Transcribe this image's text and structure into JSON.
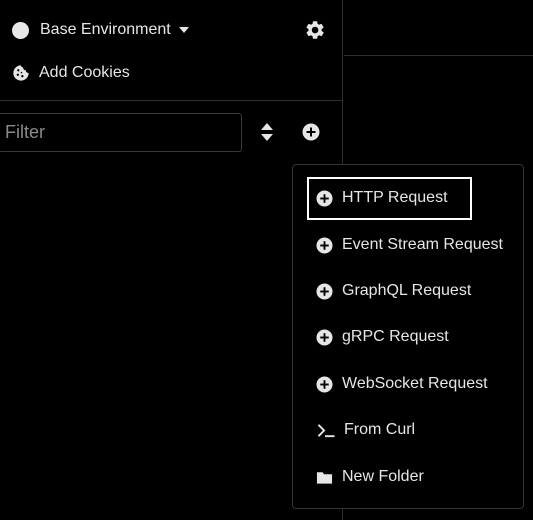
{
  "sidebar": {
    "environment": {
      "label": "Base Environment",
      "icon": "env-dot-icon"
    },
    "settings_icon": "gear-icon",
    "cookies": {
      "label": "Add Cookies",
      "icon": "cookie-icon"
    },
    "filter": {
      "placeholder": "Filter",
      "value": ""
    },
    "sort_icon": "sort-icon",
    "add_icon": "plus-circle-icon"
  },
  "create_menu": {
    "items": [
      {
        "label": "HTTP Request",
        "icon": "plus-circle-icon",
        "focused": true
      },
      {
        "label": "Event Stream Request",
        "icon": "plus-circle-icon"
      },
      {
        "label": "GraphQL Request",
        "icon": "plus-circle-icon"
      },
      {
        "label": "gRPC Request",
        "icon": "plus-circle-icon"
      },
      {
        "label": "WebSocket Request",
        "icon": "plus-circle-icon"
      },
      {
        "label": "From Curl",
        "icon": "terminal-icon"
      },
      {
        "label": "New Folder",
        "icon": "folder-icon"
      }
    ]
  },
  "colors": {
    "background": "#000000",
    "text": "#e6e6e6",
    "border": "#2e2e2e",
    "focus": "#ffffff"
  }
}
